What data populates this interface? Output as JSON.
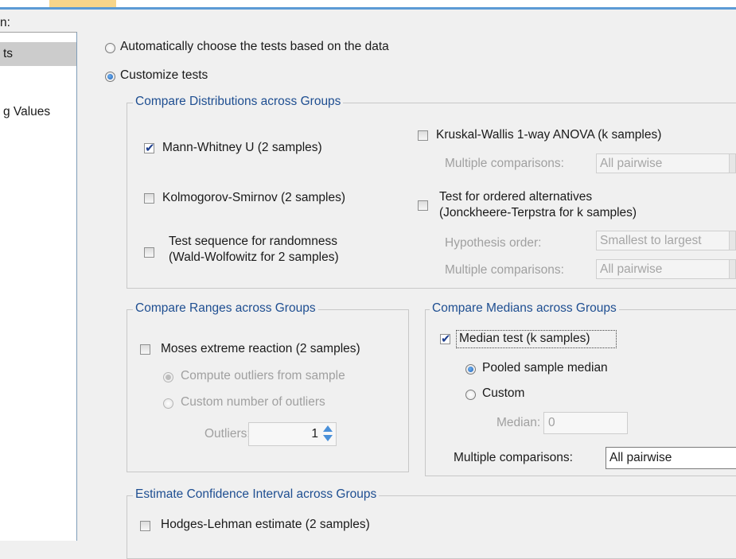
{
  "left_nav": {
    "heading": "n:",
    "items": [
      {
        "label": "ts",
        "selected": true
      },
      {
        "label": "",
        "selected": false
      },
      {
        "label": "g Values",
        "selected": false
      }
    ]
  },
  "mode": {
    "auto_label": "Automatically choose the tests based on the data",
    "auto_selected": false,
    "custom_label": "Customize tests",
    "custom_selected": true
  },
  "distributions": {
    "legend": "Compare Distributions across Groups",
    "mann_whitney": {
      "label": "Mann-Whitney U (2 samples)",
      "checked": true
    },
    "kolmogorov": {
      "label": "Kolmogorov-Smirnov (2 samples)",
      "checked": false
    },
    "wald_line1": "Test sequence for randomness",
    "wald_line2": "(Wald-Wolfowitz for 2 samples)",
    "wald_checked": false,
    "kruskal": {
      "label": "Kruskal-Wallis 1-way ANOVA (k samples)",
      "checked": false
    },
    "kruskal_mc_label": "Multiple comparisons:",
    "kruskal_mc_value": "All pairwise",
    "ordered_line1": "Test for ordered alternatives",
    "ordered_line2": "(Jonckheere-Terpstra for k samples)",
    "ordered_checked": false,
    "hyp_label": "Hypothesis order:",
    "hyp_value": "Smallest to largest",
    "ordered_mc_label": "Multiple comparisons:",
    "ordered_mc_value": "All pairwise"
  },
  "ranges": {
    "legend": "Compare Ranges across Groups",
    "moses": {
      "label": "Moses extreme reaction (2 samples)",
      "checked": false
    },
    "outliers_sample": "Compute outliers from sample",
    "outliers_custom": "Custom number of outliers",
    "outliers_label": "Outliers:",
    "outliers_value": "1"
  },
  "medians": {
    "legend": "Compare Medians across Groups",
    "median_test": {
      "label": "Median test (k samples)",
      "checked": true
    },
    "pooled": "Pooled sample median",
    "custom": "Custom",
    "median_label": "Median:",
    "median_value": "0",
    "mc_label": "Multiple comparisons:",
    "mc_value": "All pairwise"
  },
  "confidence": {
    "legend": "Estimate Confidence Interval across Groups",
    "hodges": {
      "label": "Hodges-Lehman estimate (2 samples)",
      "checked": false
    }
  },
  "colors": {
    "accent": "#1e4e91",
    "tab_accent": "#f7d58a",
    "selection": "#cccccc"
  }
}
